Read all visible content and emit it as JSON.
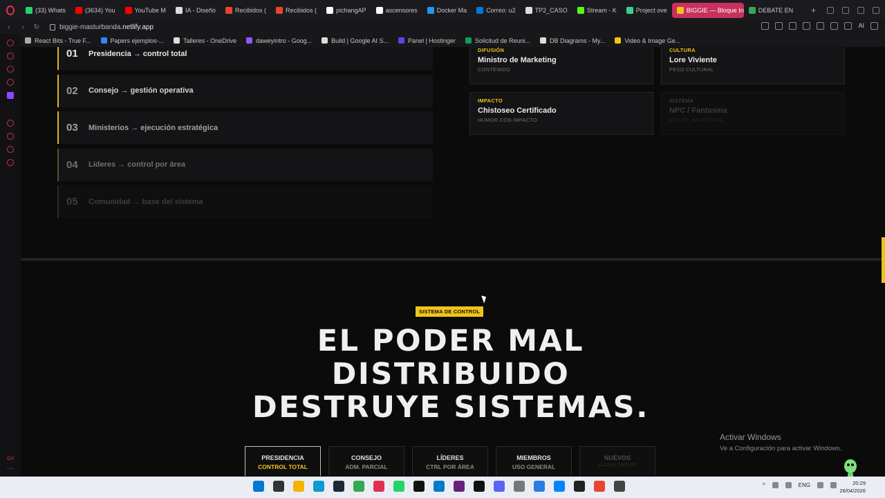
{
  "browser": {
    "tabs": [
      {
        "label": "(33) Whats",
        "color": "#25d366",
        "icon": "whatsapp-icon"
      },
      {
        "label": "(3634) You",
        "color": "#ff0000",
        "icon": "youtube-icon"
      },
      {
        "label": "YouTube M",
        "color": "#ff0000",
        "icon": "youtube-music-icon"
      },
      {
        "label": "IA - Diseño",
        "color": "#dddddd",
        "icon": "notion-icon"
      },
      {
        "label": "Recibidos (",
        "color": "#ea4335",
        "icon": "gmail-icon"
      },
      {
        "label": "Recibidos (",
        "color": "#ea4335",
        "icon": "gmail-icon"
      },
      {
        "label": "pichangAP",
        "color": "#ffffff",
        "icon": "github-icon"
      },
      {
        "label": "ascensores",
        "color": "#ffffff",
        "icon": "github-icon"
      },
      {
        "label": "Docker Ma",
        "color": "#2496ed",
        "icon": "docker-icon"
      },
      {
        "label": "Correo: u2",
        "color": "#0078d4",
        "icon": "outlook-icon"
      },
      {
        "label": "TP2_CASO",
        "color": "#dddddd",
        "icon": "document-icon"
      },
      {
        "label": "Stream - K",
        "color": "#53fc18",
        "icon": "kick-icon"
      },
      {
        "label": "Project ove",
        "color": "#3ecf8e",
        "icon": "project-icon"
      },
      {
        "label": "BIGGIE — Bloque Int",
        "color": "#f0c419",
        "icon": "biggie-icon",
        "active": true
      },
      {
        "label": "DEBATE EN",
        "color": "#34a853",
        "icon": "google-icon"
      }
    ],
    "url_prefix": "biggie-masturbanda.",
    "url_domain": "netlify.app",
    "bookmarks": [
      {
        "label": "React Bits - True F...",
        "color": "#aaaaaa"
      },
      {
        "label": "Papers ejemplos-...",
        "color": "#3b82f6"
      },
      {
        "label": "Talleres - OneDrive",
        "color": "#dddddd"
      },
      {
        "label": "daweyintro - Goog...",
        "color": "#8b5cf6"
      },
      {
        "label": "Build | Google AI S...",
        "color": "#dddddd"
      },
      {
        "label": "Panel | Hostinger",
        "color": "#673de6"
      },
      {
        "label": "Solicitud de Reuni...",
        "color": "#0f9d58"
      },
      {
        "label": "DB Diagrams - My...",
        "color": "#dddddd"
      },
      {
        "label": "Video & Image Ge...",
        "color": "#f0c419"
      }
    ],
    "ai_label": "AI"
  },
  "hierarchy": [
    {
      "num": "01",
      "label": "Presidencia → control total"
    },
    {
      "num": "02",
      "label": "Consejo → gestión operativa"
    },
    {
      "num": "03",
      "label": "Ministerios → ejecución estratégica"
    },
    {
      "num": "04",
      "label": "Líderes → control por área"
    },
    {
      "num": "05",
      "label": "Comunidad → base del sistema"
    }
  ],
  "cards": [
    {
      "cat": "DIFUSIÓN",
      "title": "Ministro de Marketing",
      "sub": "CONTENIDO"
    },
    {
      "cat": "CULTURA",
      "title": "Lore Viviente",
      "sub": "PESO CULTURAL"
    },
    {
      "cat": "IMPACTO",
      "title": "Chistoseo Certificado",
      "sub": "HUMOR CON IMPACTO"
    },
    {
      "cat": "SISTEMA",
      "title": "NPC / Fantasma",
      "sub": "EXISTE, NO APORTA"
    }
  ],
  "section": {
    "badge": "SISTEMA DE CONTROL",
    "headline_1": "EL PODER MAL",
    "headline_2": "DISTRIBUIDO",
    "headline_3": "DESTRUYE SISTEMAS."
  },
  "controls": [
    {
      "a": "PRESIDENCIA",
      "b": "CONTROL TOTAL",
      "active": true
    },
    {
      "a": "CONSEJO",
      "b": "ADM. PARCIAL"
    },
    {
      "a": "LÍDERES",
      "b": "CTRL POR ÁREA"
    },
    {
      "a": "MIEMBROS",
      "b": "USO GENERAL"
    },
    {
      "a": "NUEVOS",
      "b": "ACCESO LIMITADO",
      "dim": true
    }
  ],
  "windows_watermark": {
    "line1": "Activar Windows",
    "line2": "Ve a Configuración para activar Windows."
  },
  "taskbar": {
    "lang": "ENG",
    "time": "20:29",
    "date": "26/04/2026"
  },
  "colors": {
    "accent": "#f0c419",
    "background": "#0b0b0c",
    "active_tab": "#c9305b"
  }
}
